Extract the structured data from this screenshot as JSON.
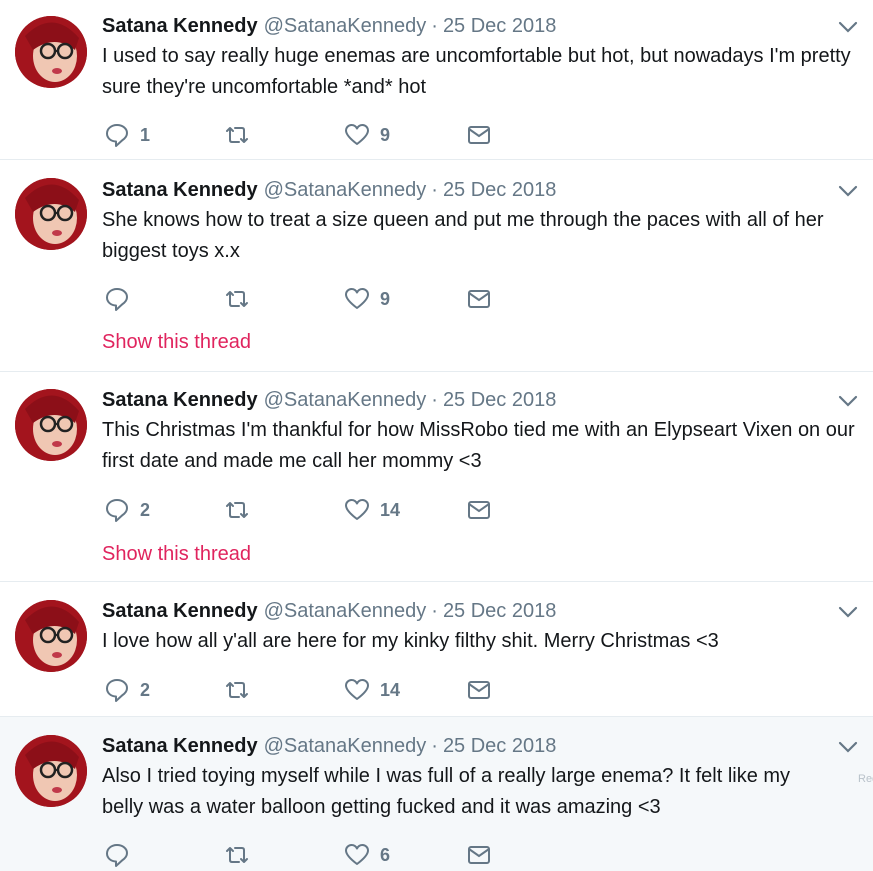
{
  "icons": {
    "avatar": "profile-photo",
    "caret": "chevron-down-icon",
    "reply": "reply-icon",
    "retweet": "retweet-icon",
    "like": "heart-icon",
    "dm": "envelope-icon"
  },
  "colors": {
    "link": "#e0245e",
    "muted": "#657786",
    "hover_bg": "#f5f8fa"
  },
  "tweets": [
    {
      "name": "Satana Kennedy",
      "handle": "@SatanaKennedy",
      "separator": "·",
      "date": "25 Dec 2018",
      "text": "I used to say really huge enemas are uncomfortable but hot, but nowadays I'm pretty sure they're uncomfortable *and* hot",
      "replies": "1",
      "retweets": "",
      "likes": "9"
    },
    {
      "name": "Satana Kennedy",
      "handle": "@SatanaKennedy",
      "separator": "·",
      "date": "25 Dec 2018",
      "text": "She knows how to treat a size queen and put me through the paces with all of her biggest toys x.x",
      "replies": "",
      "retweets": "",
      "likes": "9",
      "thread_link": "Show this thread"
    },
    {
      "name": "Satana Kennedy",
      "handle": "@SatanaKennedy",
      "separator": "·",
      "date": "25 Dec 2018",
      "text": "This Christmas I'm thankful for how MissRobo tied me with an Elypseart Vixen on our first date and made me call her mommy <3",
      "replies": "2",
      "retweets": "",
      "likes": "14",
      "thread_link": "Show this thread"
    },
    {
      "name": "Satana Kennedy",
      "handle": "@SatanaKennedy",
      "separator": "·",
      "date": "25 Dec 2018",
      "text": "I love how all y'all are here for my kinky filthy shit. Merry Christmas <3",
      "replies": "2",
      "retweets": "",
      "likes": "14"
    },
    {
      "name": "Satana Kennedy",
      "handle": "@SatanaKennedy",
      "separator": "·",
      "date": "25 Dec 2018",
      "text": "Also I tried toying myself while I was full of a really large enema? It felt like my belly was a water balloon getting fucked and it was amazing <3",
      "replies": "",
      "retweets": "",
      "likes": "6",
      "faint_tip": "Rec"
    }
  ]
}
